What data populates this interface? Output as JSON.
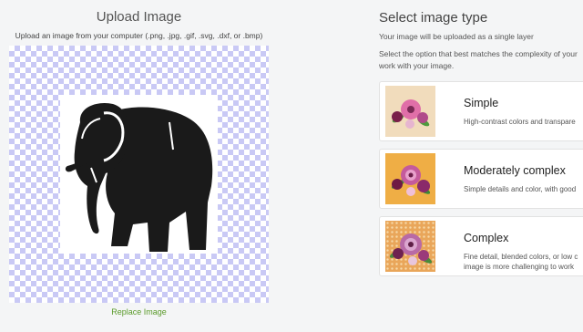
{
  "upload": {
    "title": "Upload Image",
    "subtitle": "Upload an image from your computer (.png, .jpg, .gif, .svg, .dxf, or .bmp)",
    "replace_label": "Replace Image"
  },
  "image_type": {
    "title": "Select image type",
    "subtitle": "Your image will be uploaded as a single layer",
    "instructions": "Select the option that best matches the complexity of your",
    "instructions_line2": "work with your image.",
    "options": [
      {
        "title": "Simple",
        "desc_line1": "High-contrast colors and transpare",
        "desc_line2": ""
      },
      {
        "title": "Moderately complex",
        "desc_line1": "Simple details and color, with good",
        "desc_line2": ""
      },
      {
        "title": "Complex",
        "desc_line1": "Fine detail, blended colors, or low c",
        "desc_line2": "image is more challenging to work"
      }
    ]
  },
  "colors": {
    "link_green": "#5a9a2a",
    "checker_purple": "#c9c9f5"
  }
}
